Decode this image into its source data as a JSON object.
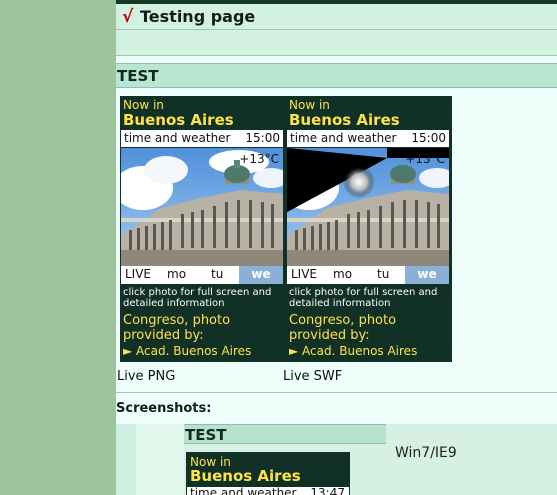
{
  "title": {
    "check": "√",
    "text": "Testing page"
  },
  "section": {
    "title": "TEST"
  },
  "widgets": [
    {
      "variant": "png",
      "now_in": "Now in",
      "city": "Buenos Aires",
      "time_weather": "time and weather",
      "time": "15:00",
      "temp": "+13°C",
      "days": {
        "live": "LIVE",
        "mo": "mo",
        "tu": "tu",
        "we": "we"
      },
      "hint": "click photo for full screen and detailed information",
      "credit": "Congreso, photo provided by:",
      "link": "► Acad. Buenos Aires",
      "caption": "Live PNG"
    },
    {
      "variant": "swf",
      "now_in": "Now in",
      "city": "Buenos Aires",
      "time_weather": "time and weather",
      "time": "15:00",
      "temp": "+13°C",
      "days": {
        "live": "LIVE",
        "mo": "mo",
        "tu": "tu",
        "we": "we"
      },
      "hint": "click photo for full screen and detailed information",
      "credit": "Congreso, photo provided by:",
      "link": "► Acad. Buenos Aires",
      "caption": "Live SWF"
    }
  ],
  "screenshots": {
    "label": "Screenshots:",
    "test_title": "TEST",
    "os": "Win7/IE9",
    "mini": {
      "now_in": "Now in",
      "city": "Buenos Aires",
      "time_weather": "time and weather",
      "time": "13:47"
    }
  },
  "colors": {
    "widget_bg": "#113026",
    "accent_yellow": "#ffe14a",
    "sidebar_green": "#9dc49b",
    "day_highlight": "#8bb0d6"
  }
}
